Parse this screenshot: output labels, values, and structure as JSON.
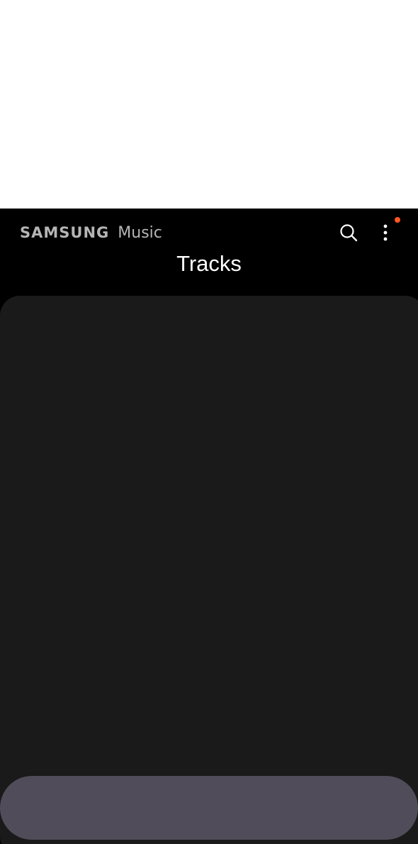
{
  "app": {
    "brand_samsung": "SAMSUNG",
    "brand_music": "Music",
    "title": "Tracks"
  },
  "toolbar": {
    "search_icon": "search-icon",
    "more_icon": "more-vert-icon",
    "has_notification_badge": true
  },
  "colors": {
    "background": "#000000",
    "panel": "#1a1a1a",
    "pill": "#504c59",
    "badge": "#ff5722",
    "brand_text": "#b5b5b5"
  }
}
